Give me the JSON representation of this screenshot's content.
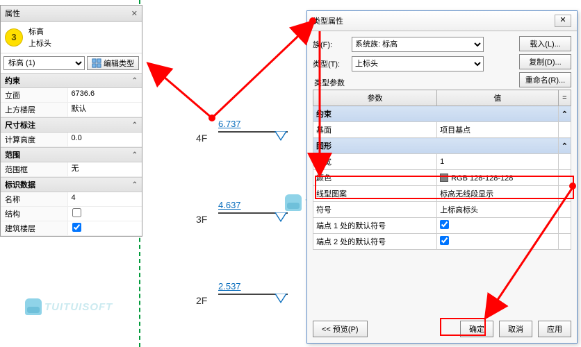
{
  "props": {
    "title": "属性",
    "type_line1": "标高",
    "type_line2": "上标头",
    "selector": "标高 (1)",
    "edit_type_btn": "编辑类型",
    "groups": {
      "constraints": {
        "label": "约束",
        "elevation_label": "立面",
        "elevation_value": "6736.6",
        "level_above_label": "上方楼层",
        "level_above_value": "默认"
      },
      "dim": {
        "label": "尺寸标注",
        "calc_height_label": "计算高度",
        "calc_height_value": "0.0"
      },
      "extent": {
        "label": "范围",
        "scope_box_label": "范围框",
        "scope_box_value": "无"
      },
      "identity": {
        "label": "标识数据",
        "name_label": "名称",
        "name_value": "4",
        "structural_label": "结构",
        "structural_checked": false,
        "building_story_label": "建筑楼层",
        "building_story_checked": true
      }
    }
  },
  "step_badge": "3",
  "canvas": {
    "levels": [
      {
        "name": "4F",
        "dim": "6.737"
      },
      {
        "name": "3F",
        "dim": "4.637"
      },
      {
        "name": "2F",
        "dim": "2.537"
      }
    ]
  },
  "wm_text": "TUITUISOFT",
  "dlg": {
    "title": "类型属性",
    "family_label": "族(F):",
    "family_value": "系统族: 标高",
    "type_label": "类型(T):",
    "type_value": "上标头",
    "load_btn": "载入(L)...",
    "dup_btn": "复制(D)...",
    "rename_btn": "重命名(R)...",
    "params_label": "类型参数",
    "col_param": "参数",
    "col_value": "值",
    "col_eq": "=",
    "grp_constraint": "约束",
    "base_label": "基面",
    "base_value": "项目基点",
    "grp_graphics": "图形",
    "lineweight_label": "线宽",
    "lineweight_value": "1",
    "color_label": "颜色",
    "color_value": "RGB 128-128-128",
    "linepattern_label": "线型图案",
    "linepattern_value": "标高无线段显示",
    "symbol_label": "符号",
    "symbol_value": "上标高标头",
    "end1_label": "端点 1 处的默认符号",
    "end1_checked": true,
    "end2_label": "端点 2 处的默认符号",
    "end2_checked": true,
    "preview_btn": "<< 预览(P)",
    "ok_btn": "确定",
    "cancel_btn": "取消",
    "apply_btn": "应用"
  }
}
